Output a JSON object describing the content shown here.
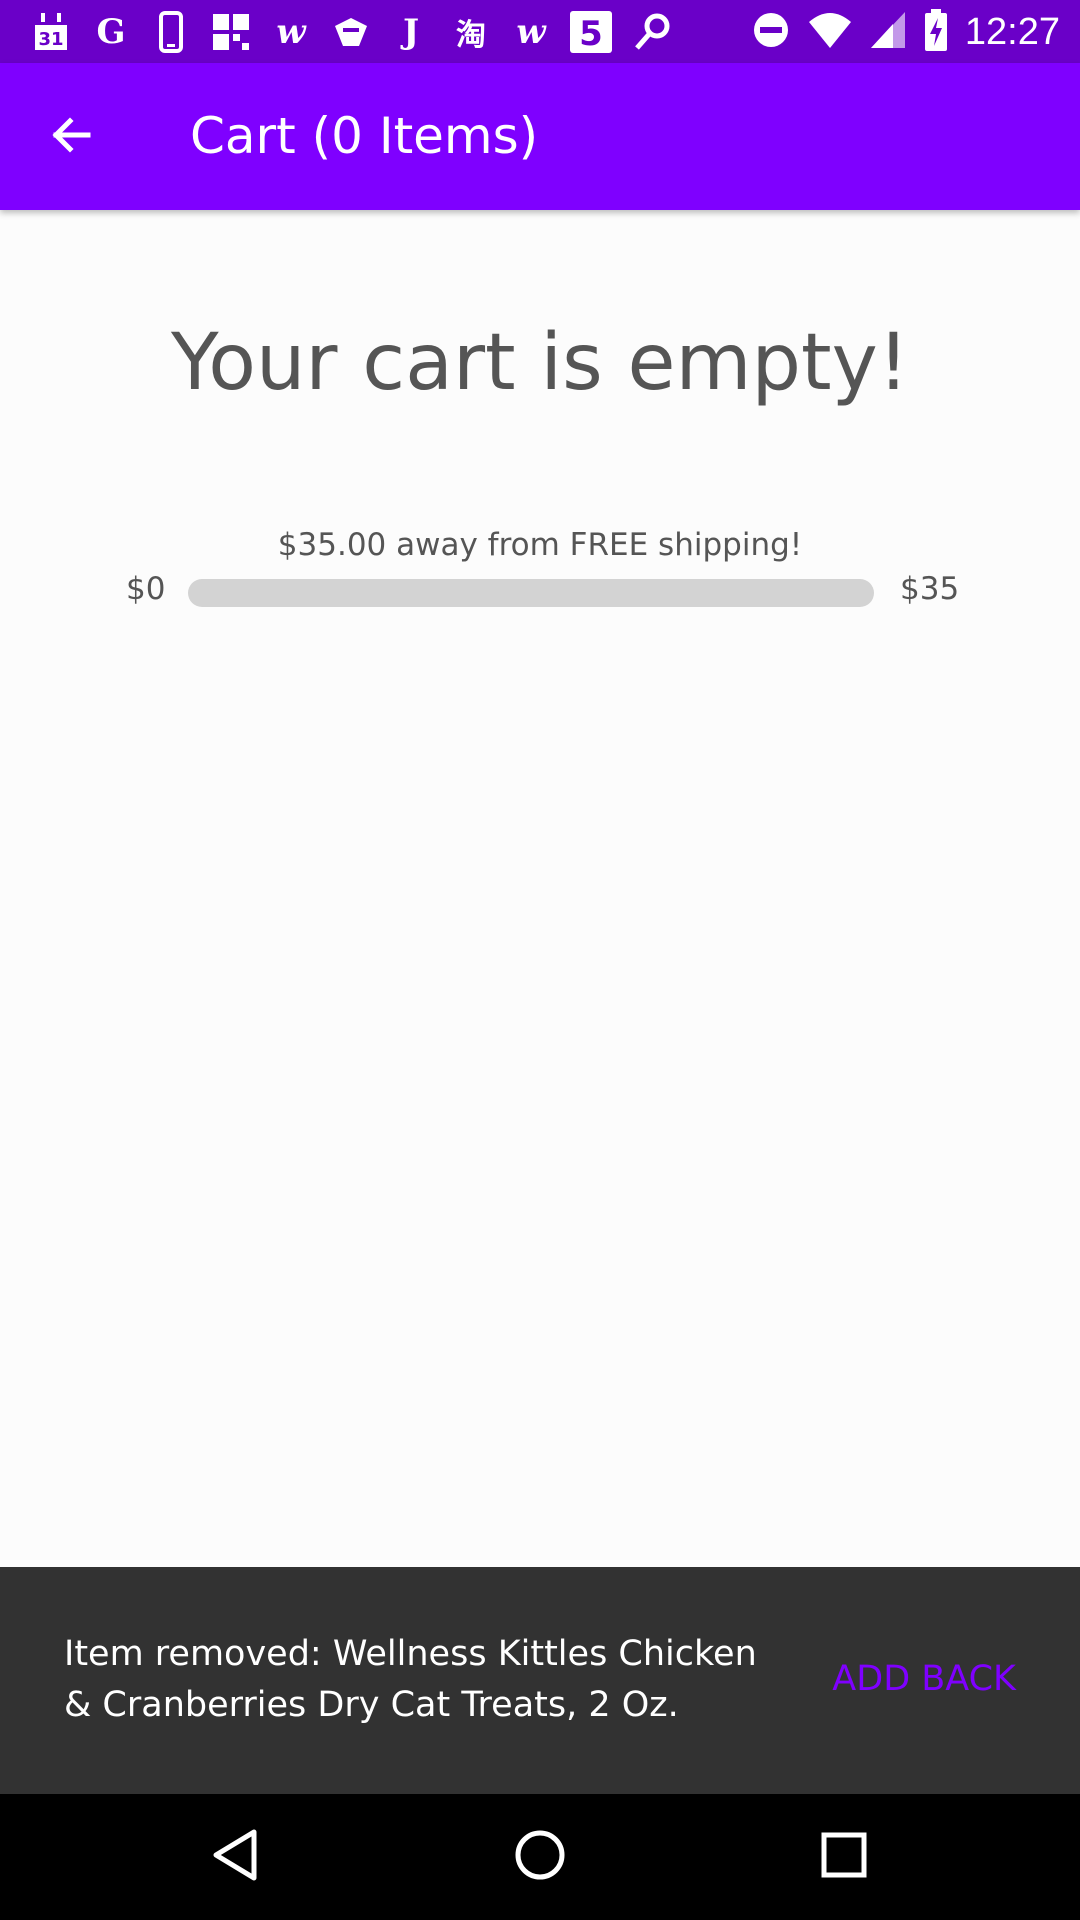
{
  "status_bar": {
    "time": "12:27",
    "notification_icons": [
      "calendar-icon",
      "google-icon",
      "phone-icon",
      "grid-app-icon",
      "w-app-icon",
      "gift-icon",
      "j-app-icon",
      "taobao-icon",
      "w-app-icon",
      "five-app-icon",
      "link-app-icon"
    ],
    "system_icons": [
      "do-not-disturb-icon",
      "wifi-icon",
      "cell-signal-icon",
      "battery-charging-icon"
    ]
  },
  "app_bar": {
    "title": "Cart (0 Items)",
    "back_icon": "back-arrow-icon"
  },
  "content": {
    "empty_message": "Your cart is empty!",
    "shipping_message": "$35.00 away from FREE shipping!",
    "range_min": "$0",
    "range_max": "$35",
    "progress_fraction": 0
  },
  "snackbar": {
    "message": "Item removed: Wellness Kittles Chicken & Cranberries Dry Cat Treats, 2 Oz.",
    "action_label": "ADD BACK"
  },
  "nav_bar": {
    "icons": [
      "nav-back-icon",
      "nav-home-icon",
      "nav-recents-icon"
    ]
  },
  "colors": {
    "status_bar": "#6a00c8",
    "app_bar": "#7f00ff",
    "accent": "#7f00ff",
    "snackbar": "#323232"
  }
}
